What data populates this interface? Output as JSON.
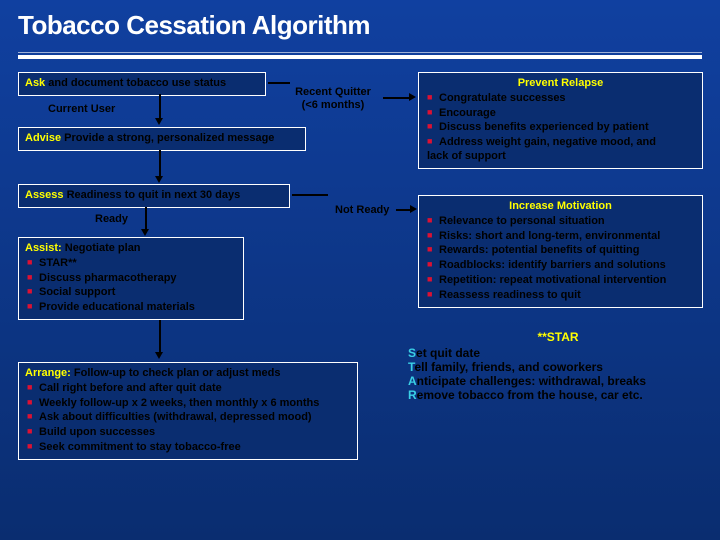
{
  "title": "Tobacco Cessation Algorithm",
  "ask": {
    "hl": "Ask",
    "rest": " and document tobacco use status"
  },
  "currentUser": "Current User",
  "recentQuitter": {
    "l1": "Recent Quitter",
    "l2": "(<6 months)"
  },
  "advise": {
    "hl": "Advise",
    "rest": " Provide a strong, personalized message"
  },
  "assess": {
    "hl": "Assess",
    "rest": " Readiness to quit in next 30 days"
  },
  "ready": "Ready",
  "notReady": "Not Ready",
  "assist": {
    "hl": "Assist:",
    "rest": " Negotiate plan",
    "items": [
      "STAR**",
      "Discuss pharmacotherapy",
      "Social support",
      "Provide educational materials"
    ]
  },
  "arrange": {
    "hl": "Arrange:",
    "rest": " Follow-up to check plan or adjust meds",
    "items": [
      "Call right before and after quit date",
      "Weekly follow-up x 2 weeks, then monthly x 6 months",
      "Ask about difficulties  (withdrawal, depressed mood)",
      "Build upon successes",
      "Seek commitment to stay tobacco-free"
    ]
  },
  "relapse": {
    "title": "Prevent Relapse",
    "items": [
      "Congratulate successes",
      "Encourage",
      "Discuss benefits experienced by patient",
      "Address weight gain, negative mood, and"
    ],
    "tail": "lack of support"
  },
  "motivation": {
    "title": "Increase Motivation",
    "items": [
      "Relevance to personal situation",
      "Risks: short and long-term, environmental",
      "Rewards: potential benefits of quitting",
      "Roadblocks: identify barriers and solutions",
      "Repetition: repeat motivational intervention",
      "Reassess readiness to quit"
    ]
  },
  "star": {
    "title": "**STAR",
    "lines": [
      {
        "a": "S",
        "b": "et quit date"
      },
      {
        "a": "T",
        "b": "ell family, friends, and coworkers"
      },
      {
        "a": "A",
        "b": "nticipate challenges: withdrawal, breaks"
      },
      {
        "a": "R",
        "b": "emove tobacco from the house, car etc."
      }
    ]
  }
}
